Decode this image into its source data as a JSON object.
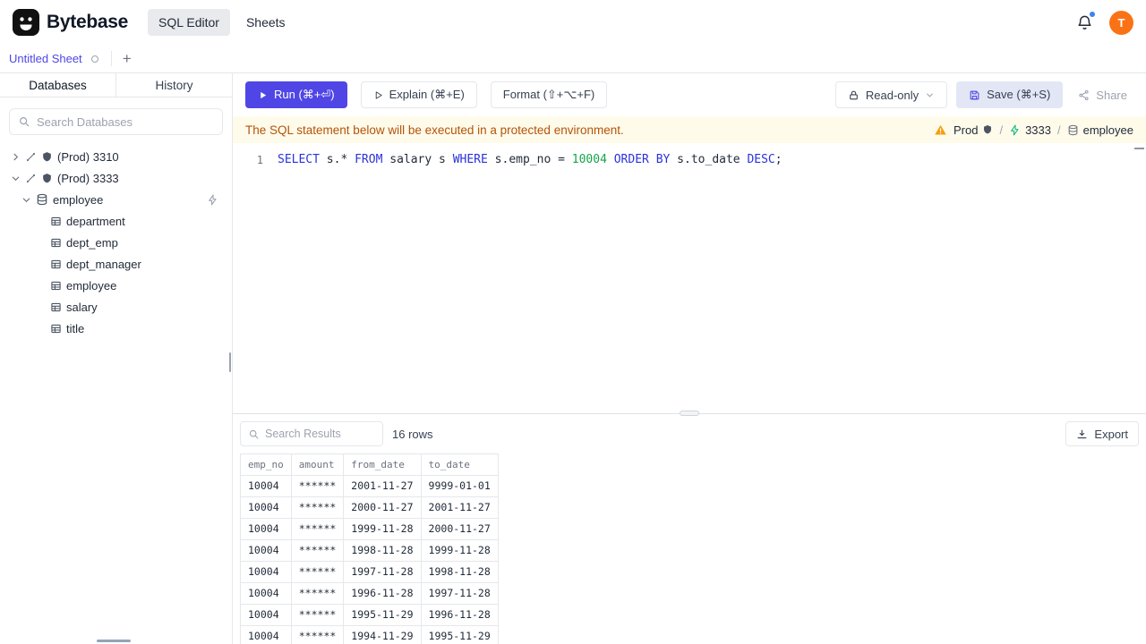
{
  "colors": {
    "accent": "#4f46e5",
    "run_button_bg": "#4f46e5",
    "save_button_bg": "#e2e6f5",
    "banner_bg": "#fffbeb",
    "banner_text": "#b45309",
    "sql_keyword": "#2b32d9",
    "sql_number": "#16a34a",
    "avatar_bg": "#f97316",
    "active_sheet_tab_text": "#4f46e5"
  },
  "header": {
    "brand": "Bytebase",
    "nav": [
      {
        "label": "SQL Editor",
        "active": true
      },
      {
        "label": "Sheets",
        "active": false
      }
    ],
    "avatar_letter": "T"
  },
  "sheet_tabs": {
    "active_tab": "Untitled Sheet",
    "new_tab_label": "+"
  },
  "sidebar": {
    "tabs": [
      {
        "label": "Databases",
        "active": true
      },
      {
        "label": "History",
        "active": false
      }
    ],
    "search_placeholder": "Search Databases",
    "tree": [
      {
        "label": "(Prod) 3310",
        "level": 0,
        "caret": "right",
        "icons": [
          "connection",
          "engine"
        ]
      },
      {
        "label": "(Prod) 3333",
        "level": 0,
        "caret": "down",
        "icons": [
          "connection",
          "engine"
        ]
      },
      {
        "label": "employee",
        "level": 1,
        "caret": "down",
        "icons": [
          "database"
        ],
        "trailing": "schema-diagram"
      },
      {
        "label": "department",
        "level": 2,
        "icons": [
          "table"
        ]
      },
      {
        "label": "dept_emp",
        "level": 2,
        "icons": [
          "table"
        ]
      },
      {
        "label": "dept_manager",
        "level": 2,
        "icons": [
          "table"
        ]
      },
      {
        "label": "employee",
        "level": 2,
        "icons": [
          "table"
        ]
      },
      {
        "label": "salary",
        "level": 2,
        "icons": [
          "table"
        ]
      },
      {
        "label": "title",
        "level": 2,
        "icons": [
          "table"
        ]
      }
    ]
  },
  "toolbar": {
    "run_label": "Run (⌘+⏎)",
    "explain_label": "Explain (⌘+E)",
    "format_label": "Format (⇧+⌥+F)",
    "readonly_label": "Read-only",
    "save_label": "Save (⌘+S)",
    "share_label": "Share"
  },
  "banner": {
    "message": "The SQL statement below will be executed in a protected environment.",
    "environment": "Prod",
    "instance": "3333",
    "database": "employee",
    "separator": "/"
  },
  "editor": {
    "line_number": "1",
    "sql_text": "SELECT s.* FROM salary s WHERE s.emp_no = 10004 ORDER BY s.to_date DESC;",
    "tokens": [
      {
        "t": "SELECT",
        "c": "kw"
      },
      {
        "t": " s.* ",
        "c": "pl"
      },
      {
        "t": "FROM",
        "c": "kw"
      },
      {
        "t": " salary s ",
        "c": "pl"
      },
      {
        "t": "WHERE",
        "c": "kw"
      },
      {
        "t": " s.emp_no = ",
        "c": "pl"
      },
      {
        "t": "10004",
        "c": "num"
      },
      {
        "t": " ",
        "c": "pl"
      },
      {
        "t": "ORDER",
        "c": "kw"
      },
      {
        "t": " ",
        "c": "pl"
      },
      {
        "t": "BY",
        "c": "kw"
      },
      {
        "t": " s.to_date ",
        "c": "pl"
      },
      {
        "t": "DESC",
        "c": "kw"
      },
      {
        "t": ";",
        "c": "pl"
      }
    ]
  },
  "results": {
    "search_placeholder": "Search Results",
    "row_count": "16 rows",
    "export_label": "Export",
    "columns": [
      "emp_no",
      "amount",
      "from_date",
      "to_date"
    ],
    "rows": [
      [
        "10004",
        "******",
        "2001-11-27",
        "9999-01-01"
      ],
      [
        "10004",
        "******",
        "2000-11-27",
        "2001-11-27"
      ],
      [
        "10004",
        "******",
        "1999-11-28",
        "2000-11-27"
      ],
      [
        "10004",
        "******",
        "1998-11-28",
        "1999-11-28"
      ],
      [
        "10004",
        "******",
        "1997-11-28",
        "1998-11-28"
      ],
      [
        "10004",
        "******",
        "1996-11-28",
        "1997-11-28"
      ],
      [
        "10004",
        "******",
        "1995-11-29",
        "1996-11-28"
      ],
      [
        "10004",
        "******",
        "1994-11-29",
        "1995-11-29"
      ]
    ]
  }
}
